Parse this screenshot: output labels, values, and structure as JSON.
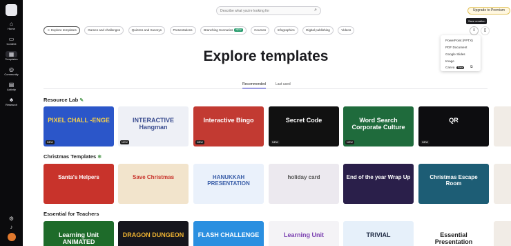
{
  "rail": [
    {
      "label": "Home",
      "icon": "home-icon"
    },
    {
      "label": "Content",
      "icon": "folder-icon"
    },
    {
      "label": "Templates",
      "icon": "templates-icon"
    },
    {
      "label": "Community",
      "icon": "community-icon"
    },
    {
      "label": "Activity",
      "icon": "activity-icon"
    },
    {
      "label": "Research",
      "icon": "research-icon"
    }
  ],
  "search": {
    "placeholder": "Describe what you're looking for"
  },
  "upgrade_label": "Upgrade to Premium",
  "chips": [
    {
      "label": "Explore templates"
    },
    {
      "label": "Games and challenges"
    },
    {
      "label": "Quizzes and Surveys"
    },
    {
      "label": "Presentations"
    },
    {
      "label": "Branching Scenarios",
      "badge": "NEW"
    },
    {
      "label": "Courses"
    },
    {
      "label": "Infographics"
    },
    {
      "label": "Digital publishing"
    },
    {
      "label": "Videos"
    }
  ],
  "tooltip": "Save creation",
  "export_menu": {
    "items": [
      "PowerPoint (PPTX)",
      "PDF Document",
      "Google Slides",
      "Image"
    ],
    "canva": {
      "label": "Canva",
      "tag": "Beta"
    }
  },
  "title": "Explore templates",
  "tabs": [
    "Recommended",
    "Last used"
  ],
  "sections": [
    {
      "title": "Resource Lab",
      "emoji": "✎"
    },
    {
      "title": "Christmas Templates",
      "emoji": "❄"
    },
    {
      "title": "Essential for Teachers",
      "emoji": ""
    }
  ],
  "cards": {
    "resource": [
      {
        "text": "PIXEL CHALL -ENGE",
        "badge": "NEW",
        "bg": "#2b56c9",
        "color": "#f8d24a"
      },
      {
        "text": "INTERACTIVE Hangman",
        "badge": "NEW",
        "bg": "#eef0f6",
        "color": "#3a4c8f"
      },
      {
        "text": "Interactive Bingo",
        "badge": "NEW",
        "bg": "#c23a32",
        "color": "#ffffff"
      },
      {
        "text": "Secret Code",
        "badge": "NEW",
        "bg": "#111111",
        "color": "#ffffff"
      },
      {
        "text": "Word Search Corporate Culture",
        "badge": "NEW",
        "bg": "#1f6b3c",
        "color": "#ffffff"
      },
      {
        "text": "QR",
        "badge": "NEW",
        "bg": "#0d0d10",
        "color": "#ffffff"
      }
    ],
    "christmas": [
      {
        "text": "Santa's Helpers",
        "bg": "#c8332b",
        "color": "#ffffff"
      },
      {
        "text": "Save Christmas",
        "bg": "#f2e4cc",
        "color": "#c8332b"
      },
      {
        "text": "HANUKKAH PRESENTATION",
        "bg": "#eaf1fb",
        "color": "#3a5ea8"
      },
      {
        "text": "holiday card",
        "bg": "#ece9ef",
        "color": "#555555"
      },
      {
        "text": "End of the year Wrap Up",
        "bg": "#2a1f4a",
        "color": "#ffffff"
      },
      {
        "text": "Christmas Escape Room",
        "bg": "#1d5d75",
        "color": "#ffffff"
      }
    ],
    "teachers": [
      {
        "text": "Learning Unit ANIMATED",
        "bg": "#1e6b2a",
        "color": "#ffffff"
      },
      {
        "text": "DRAGON DUNGEON",
        "bg": "#16161d",
        "color": "#f1b432"
      },
      {
        "text": "FLASH CHALLENGE",
        "bg": "#2a8fe0",
        "color": "#ffffff"
      },
      {
        "text": "Learning Unit",
        "bg": "#f4f3f6",
        "color": "#7a3fb0"
      },
      {
        "text": "TRIVIAL",
        "bg": "#e6f0fa",
        "color": "#1e2a44"
      },
      {
        "text": "Essential Presentation",
        "bg": "#ffffff",
        "color": "#1e1e1e"
      }
    ]
  }
}
